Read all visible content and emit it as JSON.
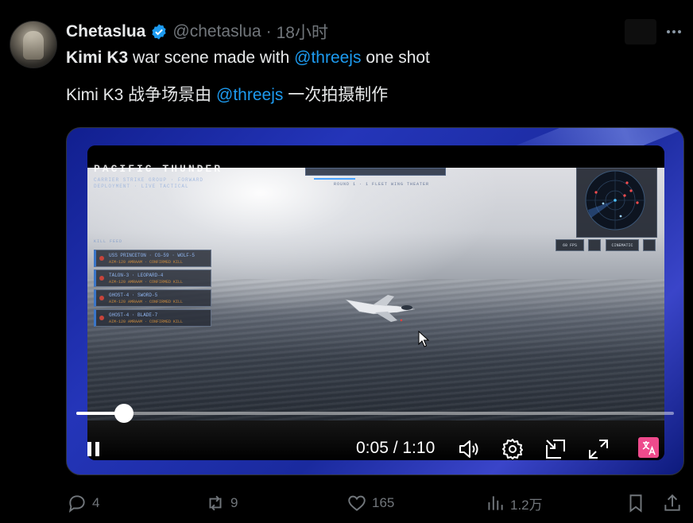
{
  "tweet": {
    "author_name": "Chetaslua",
    "handle": "@chetaslua",
    "separator": "·",
    "time": "18小时",
    "line1": {
      "bold": "Kimi K3",
      "text": " war scene made with ",
      "mention": "@threejs",
      "tail": " one shot"
    },
    "line2": {
      "text": "Kimi K3 战争场景由 ",
      "mention": "@threejs",
      "tail": " 一次拍摄制作"
    }
  },
  "video": {
    "timecode": "0:05 / 1:10",
    "progress_fraction": 0.08,
    "hud": {
      "title": "PACIFIC THUNDER",
      "subtitle": "CARRIER STRIKE GROUP · FORWARD DEPLOYMENT · LIVE TACTICAL",
      "tabs_caption": "ROUND 1 · 1 FLEET WING THEATER",
      "kills_header": "KILL FEED",
      "controls": [
        "60 FPS",
        "",
        "CINEMATIC",
        ""
      ],
      "kill_feed": [
        {
          "line1": "USS PRINCETON · CG-59 · WOLF-5",
          "line2": "AIM-120 AMRAAM · CONFIRMED KILL"
        },
        {
          "line1": "TALON-3 · LEOPARD-4",
          "line2": "AIM-120 AMRAAM · CONFIRMED KILL"
        },
        {
          "line1": "GHOST-4 · SWORD-5",
          "line2": "AIM-120 AMRAAM · CONFIRMED KILL"
        },
        {
          "line1": "GHOST-4 · BLADE-7",
          "line2": "AIM-120 AMRAAM · CONFIRMED KILL"
        }
      ]
    }
  },
  "actions": {
    "replies": "4",
    "reposts": "9",
    "likes": "165",
    "views": "1.2万"
  },
  "colors": {
    "accent": "#1d9bf0",
    "muted": "#71767b",
    "translate_badge": "#ee4a8c"
  }
}
